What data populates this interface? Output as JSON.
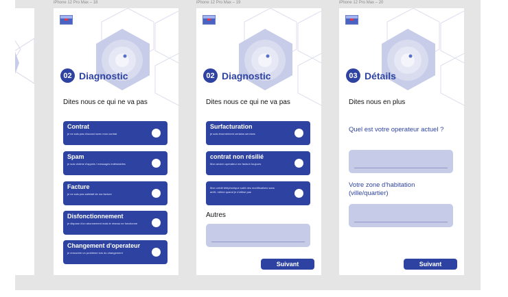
{
  "frames": [
    {
      "label": "iPhone 12 Pro Max – 18"
    },
    {
      "label": "iPhone 12 Pro Max – 19"
    },
    {
      "label": "iPhone 12 Pro Max – 20"
    }
  ],
  "screen18": {
    "step": "02",
    "title": "Diagnostic",
    "subtitle": "Dites nous ce qui ne va pas",
    "options": [
      {
        "title": "Contrat",
        "desc": "je ne suis pas d'accord avec mon contrat"
      },
      {
        "title": "Spam",
        "desc": "je suis victime d'appels / messages indésirables"
      },
      {
        "title": "Facture",
        "desc": "je ne suis pas satisfait de ma facture"
      },
      {
        "title": "Disfonctionnement",
        "desc": "je dispose d'un abonnement mais le réseau ne fonctionne"
      },
      {
        "title": "Changement d'operateur",
        "desc": "je rencontre un problème lors du changement"
      }
    ]
  },
  "screen19": {
    "step": "02",
    "title": "Diagnostic",
    "subtitle": "Dites nous ce qui ne va pas",
    "options": [
      {
        "title": "Surfacturation",
        "desc": "je suis énormément certains services"
      },
      {
        "title": "contrat non résilié",
        "desc": "Mon ancien operateur me facture toujours"
      },
      {
        "title": "",
        "desc": "Mon crédit téléphonique subit des modifications sans arrêt, même quand je n'utilise pas"
      }
    ],
    "other_label": "Autres",
    "next_label": "Suivant"
  },
  "screen20": {
    "step": "03",
    "title": "Détails",
    "subtitle": "Dites nous en plus",
    "q1": "Quel est votre operateur actuel ?",
    "q2": "Votre zone d'habitation (ville/quartier)",
    "next_label": "Suivant"
  },
  "colors": {
    "primary": "#2e43a1",
    "field": "#c6cbe8",
    "canvas": "#e5e5e5"
  }
}
